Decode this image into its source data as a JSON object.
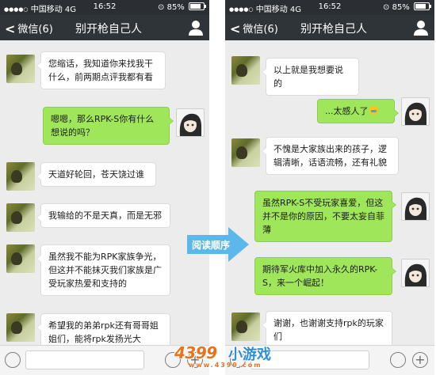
{
  "left_phone": {
    "status": {
      "carrier": "中国移动",
      "network": "4G",
      "time": "16:52",
      "battery": "85%"
    },
    "nav": {
      "back_label": "微信(6)",
      "title": "别开枪自己人"
    },
    "messages": [
      {
        "side": "in",
        "text": "您缩话，我知道你来找我干什么，前两期点评我都有看"
      },
      {
        "side": "out",
        "text": "嗯嗯，那么RPK-S你有什么想说的吗？"
      },
      {
        "side": "in",
        "text": "天道好轮回，苍天饶过谁"
      },
      {
        "side": "in",
        "text": "我输给的不是天真，而是无邪"
      },
      {
        "side": "in",
        "text": "虽然我不能为RPK家族争光，但这并不能抹灭我们家族是广受玩家热爱和支持的"
      },
      {
        "side": "in",
        "text": "希望我的弟弟rpk还有哥哥姐姐们，能将rpk发扬光大"
      }
    ]
  },
  "right_phone": {
    "status": {
      "carrier": "中国移动",
      "network": "4G",
      "time": "16:52",
      "battery": "85%"
    },
    "nav": {
      "back_label": "微信(6)",
      "title": "别开枪自己人"
    },
    "messages": [
      {
        "side": "in",
        "text": "以上就是我想要说的"
      },
      {
        "side": "out",
        "text": "...太感人了"
      },
      {
        "side": "in",
        "text": "不愧是大家族出来的孩子，逻辑清晰，话语流畅，还有礼貌"
      },
      {
        "side": "out",
        "text": "虽然RPK-S不受玩家喜爱，但这并不是你的原因，不要太妄自菲薄"
      },
      {
        "side": "out",
        "text": "期待军火库中加入永久的RPK-S，来一个崛起！"
      },
      {
        "side": "in",
        "text": "谢谢，也谢谢支持rpk的玩家们"
      }
    ]
  },
  "arrow": {
    "label": "阅读顺序"
  },
  "watermark": {
    "brand": "4399",
    "game": "小游戏",
    "url": "www.4399.com"
  },
  "colors": {
    "bubble_out": "#9fe65a",
    "bubble_in": "#ffffff",
    "nav_bg": "#2f3438",
    "arrow": "#5cb8ea"
  }
}
